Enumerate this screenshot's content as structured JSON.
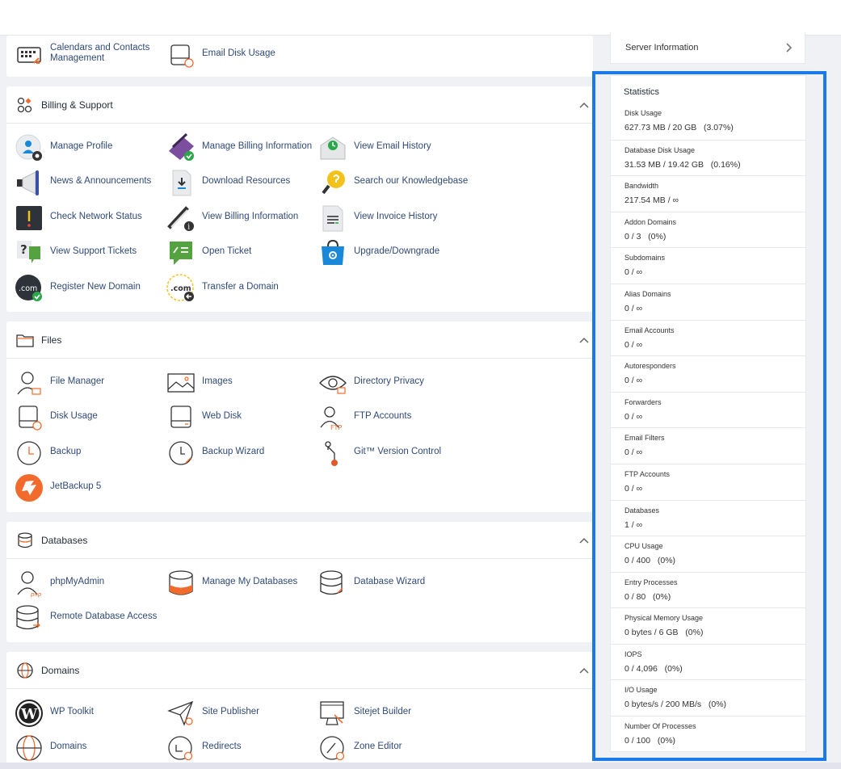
{
  "top_partial": {
    "items": [
      {
        "label": "Calendars and Contacts Management",
        "icon": "calendar-icon"
      },
      {
        "label": "Email Disk Usage",
        "icon": "disk-icon"
      }
    ]
  },
  "sections": [
    {
      "title": "Billing & Support",
      "icon": "grid-icon",
      "items": [
        {
          "label": "Manage Profile",
          "icon": "profile-icon"
        },
        {
          "label": "Manage Billing Information",
          "icon": "credit-card-icon"
        },
        {
          "label": "View Email History",
          "icon": "email-history-icon"
        },
        {
          "label": "News & Announcements",
          "icon": "megaphone-icon"
        },
        {
          "label": "Download Resources",
          "icon": "download-icon"
        },
        {
          "label": "Search our Knowledgebase",
          "icon": "knowledgebase-icon"
        },
        {
          "label": "Check Network Status",
          "icon": "network-status-icon"
        },
        {
          "label": "View Billing Information",
          "icon": "billing-info-icon"
        },
        {
          "label": "View Invoice History",
          "icon": "invoice-icon"
        },
        {
          "label": "View Support Tickets",
          "icon": "tickets-icon"
        },
        {
          "label": "Open Ticket",
          "icon": "open-ticket-icon"
        },
        {
          "label": "Upgrade/Downgrade",
          "icon": "upgrade-bag-icon"
        },
        {
          "label": "Register New Domain",
          "icon": "register-domain-icon"
        },
        {
          "label": "Transfer a Domain",
          "icon": "transfer-domain-icon"
        }
      ]
    },
    {
      "title": "Files",
      "icon": "folder-icon",
      "items": [
        {
          "label": "File Manager",
          "icon": "file-manager-icon"
        },
        {
          "label": "Images",
          "icon": "images-icon"
        },
        {
          "label": "Directory Privacy",
          "icon": "eye-icon"
        },
        {
          "label": "Disk Usage",
          "icon": "disk-usage-icon"
        },
        {
          "label": "Web Disk",
          "icon": "web-disk-icon"
        },
        {
          "label": "FTP Accounts",
          "icon": "ftp-icon"
        },
        {
          "label": "Backup",
          "icon": "backup-icon"
        },
        {
          "label": "Backup Wizard",
          "icon": "backup-wizard-icon"
        },
        {
          "label": "Git™ Version Control",
          "icon": "git-icon"
        },
        {
          "label": "JetBackup 5",
          "icon": "jetbackup-icon"
        }
      ]
    },
    {
      "title": "Databases",
      "icon": "database-icon",
      "items": [
        {
          "label": "phpMyAdmin",
          "icon": "phpmyadmin-icon"
        },
        {
          "label": "Manage My Databases",
          "icon": "manage-db-icon"
        },
        {
          "label": "Database Wizard",
          "icon": "db-wizard-icon"
        },
        {
          "label": "Remote Database Access",
          "icon": "remote-db-icon"
        }
      ]
    },
    {
      "title": "Domains",
      "icon": "globe-icon",
      "items": [
        {
          "label": "WP Toolkit",
          "icon": "wordpress-icon"
        },
        {
          "label": "Site Publisher",
          "icon": "paper-plane-icon"
        },
        {
          "label": "Sitejet Builder",
          "icon": "sitejet-icon"
        },
        {
          "label": "Domains",
          "icon": "domains-globe-icon"
        },
        {
          "label": "Redirects",
          "icon": "redirects-icon"
        },
        {
          "label": "Zone Editor",
          "icon": "zone-editor-icon"
        }
      ]
    }
  ],
  "server_info": {
    "label": "Server Information"
  },
  "statistics": {
    "title": "Statistics",
    "rows": [
      {
        "name": "Disk Usage",
        "value": "627.73 MB / 20 GB   (3.07%)"
      },
      {
        "name": "Database Disk Usage",
        "value": "31.53 MB / 19.42 GB   (0.16%)"
      },
      {
        "name": "Bandwidth",
        "value": "217.54 MB / ∞"
      },
      {
        "name": "Addon Domains",
        "value": "0 / 3   (0%)"
      },
      {
        "name": "Subdomains",
        "value": "0 / ∞"
      },
      {
        "name": "Alias Domains",
        "value": "0 / ∞"
      },
      {
        "name": "Email Accounts",
        "value": "0 / ∞"
      },
      {
        "name": "Autoresponders",
        "value": "0 / ∞"
      },
      {
        "name": "Forwarders",
        "value": "0 / ∞"
      },
      {
        "name": "Email Filters",
        "value": "0 / ∞"
      },
      {
        "name": "FTP Accounts",
        "value": "0 / ∞"
      },
      {
        "name": "Databases",
        "value": "1 / ∞"
      },
      {
        "name": "CPU Usage",
        "value": "0 / 400   (0%)"
      },
      {
        "name": "Entry Processes",
        "value": "0 / 80   (0%)"
      },
      {
        "name": "Physical Memory Usage",
        "value": "0 bytes / 6 GB   (0%)"
      },
      {
        "name": "IOPS",
        "value": "0 / 4,096   (0%)"
      },
      {
        "name": "I/O Usage",
        "value": "0 bytes/s / 200 MB/s   (0%)"
      },
      {
        "name": "Number Of Processes",
        "value": "0 / 100   (0%)"
      }
    ]
  },
  "colors": {
    "accent": "#1a7ae8",
    "link": "#2f4a78",
    "orange": "#f26b2c"
  }
}
